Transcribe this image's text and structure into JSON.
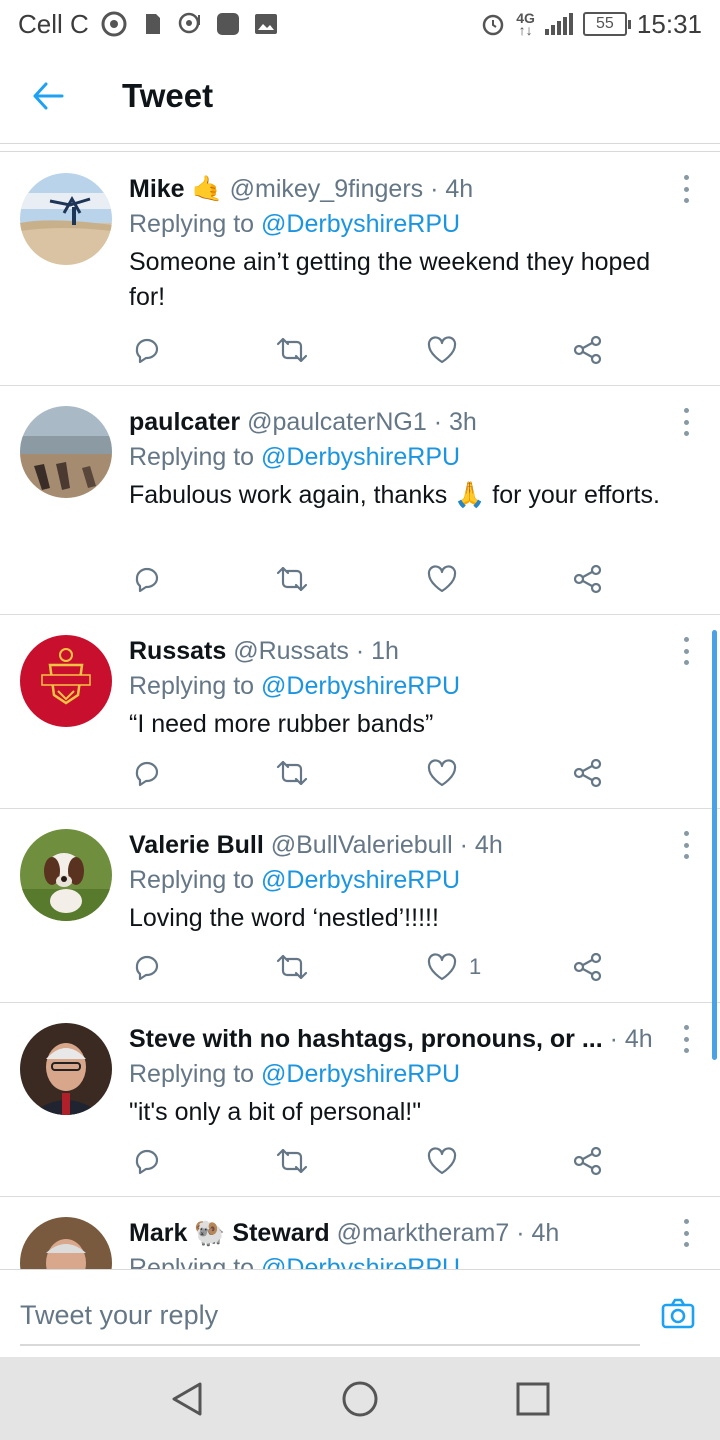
{
  "status_bar": {
    "carrier": "Cell C",
    "network": "4G",
    "battery": "55",
    "time": "15:31"
  },
  "header": {
    "title": "Tweet"
  },
  "tweets": [
    {
      "name": "Mike",
      "emoji": "🤙",
      "handle": "@mikey_9fingers",
      "time": "· 4h",
      "replying_prefix": "Replying to",
      "replying_to": "@DerbyshireRPU",
      "text": "Someone ain’t getting the weekend they hoped for!",
      "likes": ""
    },
    {
      "name": "paulcater",
      "handle": "@paulcaterNG1",
      "time": "· 3h",
      "replying_prefix": "Replying to",
      "replying_to": "@DerbyshireRPU",
      "text": "Fabulous work again, thanks 🙏 for your efforts.",
      "likes": ""
    },
    {
      "name": "Russats",
      "handle": "@Russats",
      "time": "· 1h",
      "replying_prefix": "Replying to",
      "replying_to": "@DerbyshireRPU",
      "text": "“I need more rubber bands”",
      "likes": ""
    },
    {
      "name": "Valerie Bull",
      "handle": "@BullValeriebull",
      "time": "· 4h",
      "replying_prefix": "Replying to",
      "replying_to": "@DerbyshireRPU",
      "text": "Loving the word ‘nestled’!!!!!",
      "likes": "1"
    },
    {
      "name": "Steve with no hashtags, pronouns, or ...",
      "handle": "",
      "time": "· 4h",
      "replying_prefix": "Replying to",
      "replying_to": "@DerbyshireRPU",
      "text": "\"it's only a bit of personal!\"",
      "likes": ""
    },
    {
      "name": "Mark",
      "emoji": "🐏",
      "name2": "Steward",
      "handle": "@marktheram7",
      "time": "· 4h",
      "replying_prefix": "Replying to",
      "replying_to": "@DerbyshireRPU",
      "text": "",
      "likes": ""
    }
  ],
  "reply_bar": {
    "placeholder": "Tweet your reply"
  },
  "colors": {
    "accent": "#1b95e0",
    "secondary_text": "#657786",
    "primary_text": "#0f1419"
  },
  "icons": [
    "back-arrow-icon",
    "reply-icon",
    "retweet-icon",
    "like-icon",
    "share-icon",
    "more-icon",
    "camera-icon",
    "nav-back-icon",
    "nav-home-icon",
    "nav-recents-icon"
  ]
}
